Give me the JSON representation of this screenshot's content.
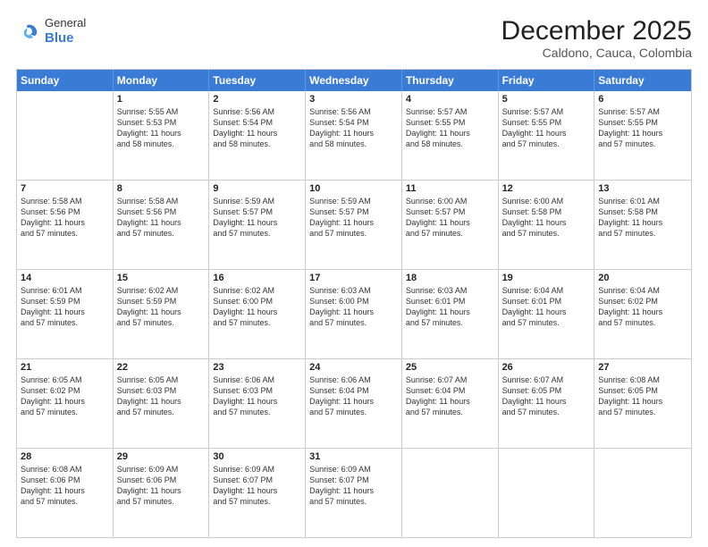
{
  "header": {
    "logo_line1": "General",
    "logo_line2": "Blue",
    "month_year": "December 2025",
    "location": "Caldono, Cauca, Colombia"
  },
  "days_of_week": [
    "Sunday",
    "Monday",
    "Tuesday",
    "Wednesday",
    "Thursday",
    "Friday",
    "Saturday"
  ],
  "weeks": [
    [
      {
        "day": "",
        "text": ""
      },
      {
        "day": "1",
        "text": "Sunrise: 5:55 AM\nSunset: 5:53 PM\nDaylight: 11 hours\nand 58 minutes."
      },
      {
        "day": "2",
        "text": "Sunrise: 5:56 AM\nSunset: 5:54 PM\nDaylight: 11 hours\nand 58 minutes."
      },
      {
        "day": "3",
        "text": "Sunrise: 5:56 AM\nSunset: 5:54 PM\nDaylight: 11 hours\nand 58 minutes."
      },
      {
        "day": "4",
        "text": "Sunrise: 5:57 AM\nSunset: 5:55 PM\nDaylight: 11 hours\nand 58 minutes."
      },
      {
        "day": "5",
        "text": "Sunrise: 5:57 AM\nSunset: 5:55 PM\nDaylight: 11 hours\nand 57 minutes."
      },
      {
        "day": "6",
        "text": "Sunrise: 5:57 AM\nSunset: 5:55 PM\nDaylight: 11 hours\nand 57 minutes."
      }
    ],
    [
      {
        "day": "7",
        "text": "Sunrise: 5:58 AM\nSunset: 5:56 PM\nDaylight: 11 hours\nand 57 minutes."
      },
      {
        "day": "8",
        "text": "Sunrise: 5:58 AM\nSunset: 5:56 PM\nDaylight: 11 hours\nand 57 minutes."
      },
      {
        "day": "9",
        "text": "Sunrise: 5:59 AM\nSunset: 5:57 PM\nDaylight: 11 hours\nand 57 minutes."
      },
      {
        "day": "10",
        "text": "Sunrise: 5:59 AM\nSunset: 5:57 PM\nDaylight: 11 hours\nand 57 minutes."
      },
      {
        "day": "11",
        "text": "Sunrise: 6:00 AM\nSunset: 5:57 PM\nDaylight: 11 hours\nand 57 minutes."
      },
      {
        "day": "12",
        "text": "Sunrise: 6:00 AM\nSunset: 5:58 PM\nDaylight: 11 hours\nand 57 minutes."
      },
      {
        "day": "13",
        "text": "Sunrise: 6:01 AM\nSunset: 5:58 PM\nDaylight: 11 hours\nand 57 minutes."
      }
    ],
    [
      {
        "day": "14",
        "text": "Sunrise: 6:01 AM\nSunset: 5:59 PM\nDaylight: 11 hours\nand 57 minutes."
      },
      {
        "day": "15",
        "text": "Sunrise: 6:02 AM\nSunset: 5:59 PM\nDaylight: 11 hours\nand 57 minutes."
      },
      {
        "day": "16",
        "text": "Sunrise: 6:02 AM\nSunset: 6:00 PM\nDaylight: 11 hours\nand 57 minutes."
      },
      {
        "day": "17",
        "text": "Sunrise: 6:03 AM\nSunset: 6:00 PM\nDaylight: 11 hours\nand 57 minutes."
      },
      {
        "day": "18",
        "text": "Sunrise: 6:03 AM\nSunset: 6:01 PM\nDaylight: 11 hours\nand 57 minutes."
      },
      {
        "day": "19",
        "text": "Sunrise: 6:04 AM\nSunset: 6:01 PM\nDaylight: 11 hours\nand 57 minutes."
      },
      {
        "day": "20",
        "text": "Sunrise: 6:04 AM\nSunset: 6:02 PM\nDaylight: 11 hours\nand 57 minutes."
      }
    ],
    [
      {
        "day": "21",
        "text": "Sunrise: 6:05 AM\nSunset: 6:02 PM\nDaylight: 11 hours\nand 57 minutes."
      },
      {
        "day": "22",
        "text": "Sunrise: 6:05 AM\nSunset: 6:03 PM\nDaylight: 11 hours\nand 57 minutes."
      },
      {
        "day": "23",
        "text": "Sunrise: 6:06 AM\nSunset: 6:03 PM\nDaylight: 11 hours\nand 57 minutes."
      },
      {
        "day": "24",
        "text": "Sunrise: 6:06 AM\nSunset: 6:04 PM\nDaylight: 11 hours\nand 57 minutes."
      },
      {
        "day": "25",
        "text": "Sunrise: 6:07 AM\nSunset: 6:04 PM\nDaylight: 11 hours\nand 57 minutes."
      },
      {
        "day": "26",
        "text": "Sunrise: 6:07 AM\nSunset: 6:05 PM\nDaylight: 11 hours\nand 57 minutes."
      },
      {
        "day": "27",
        "text": "Sunrise: 6:08 AM\nSunset: 6:05 PM\nDaylight: 11 hours\nand 57 minutes."
      }
    ],
    [
      {
        "day": "28",
        "text": "Sunrise: 6:08 AM\nSunset: 6:06 PM\nDaylight: 11 hours\nand 57 minutes."
      },
      {
        "day": "29",
        "text": "Sunrise: 6:09 AM\nSunset: 6:06 PM\nDaylight: 11 hours\nand 57 minutes."
      },
      {
        "day": "30",
        "text": "Sunrise: 6:09 AM\nSunset: 6:07 PM\nDaylight: 11 hours\nand 57 minutes."
      },
      {
        "day": "31",
        "text": "Sunrise: 6:09 AM\nSunset: 6:07 PM\nDaylight: 11 hours\nand 57 minutes."
      },
      {
        "day": "",
        "text": ""
      },
      {
        "day": "",
        "text": ""
      },
      {
        "day": "",
        "text": ""
      }
    ]
  ]
}
